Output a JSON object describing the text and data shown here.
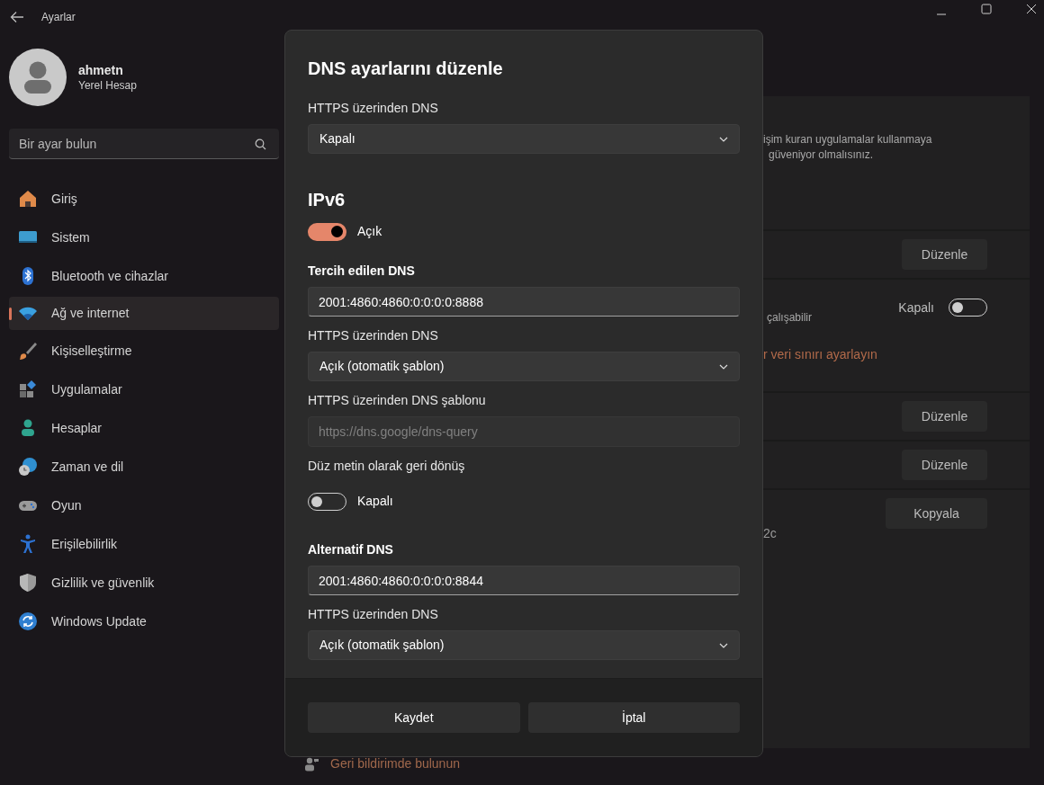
{
  "window": {
    "title": "Ayarlar"
  },
  "user": {
    "name": "ahmetn",
    "account_type": "Yerel Hesap"
  },
  "search": {
    "placeholder": "Bir ayar bulun"
  },
  "sidebar": {
    "items": [
      {
        "label": "Giriş",
        "selected": false
      },
      {
        "label": "Sistem",
        "selected": false
      },
      {
        "label": "Bluetooth ve cihazlar",
        "selected": false
      },
      {
        "label": "Ağ ve internet",
        "selected": true
      },
      {
        "label": "Kişiselleştirme",
        "selected": false
      },
      {
        "label": "Uygulamalar",
        "selected": false
      },
      {
        "label": "Hesaplar",
        "selected": false
      },
      {
        "label": "Zaman ve dil",
        "selected": false
      },
      {
        "label": "Oyun",
        "selected": false
      },
      {
        "label": "Erişilebilirlik",
        "selected": false
      },
      {
        "label": "Gizlilik ve güvenlik",
        "selected": false
      },
      {
        "label": "Windows Update",
        "selected": false
      }
    ]
  },
  "background_panel": {
    "description_lines": [
      "işim kuran uygulamalar kullanmaya",
      "güveniyor olmalısınız."
    ],
    "rows": [
      {
        "kind": "button",
        "button": "Düzenle"
      },
      {
        "kind": "toggle",
        "text": "çalışabilir",
        "toggle_label": "Kapalı",
        "on": false,
        "link": "r veri sınırı ayarlayın"
      },
      {
        "kind": "button",
        "button": "Düzenle"
      },
      {
        "kind": "button",
        "button": "Düzenle"
      },
      {
        "kind": "button",
        "button": "Kopyala",
        "text": "2c"
      }
    ],
    "feedback_link": "Geri bildirimde bulunun"
  },
  "dialog": {
    "title": "DNS ayarlarını düzenle",
    "items": [
      {
        "kind": "dropdown",
        "label": "HTTPS üzerinden DNS",
        "value": "Kapalı"
      },
      {
        "kind": "heading",
        "text": "IPv6"
      },
      {
        "kind": "toggle",
        "state_label": "Açık",
        "on": true
      },
      {
        "kind": "address_input",
        "label": "Tercih edilen DNS",
        "value": "2001:4860:4860:0:0:0:0:8888"
      },
      {
        "kind": "dropdown",
        "label": "HTTPS üzerinden DNS",
        "value": "Açık (otomatik şablon)"
      },
      {
        "kind": "text_input",
        "label": "HTTPS üzerinden DNS şablonu",
        "placeholder": "https://dns.google/dns-query"
      },
      {
        "kind": "toggle",
        "label": "Düz metin olarak geri dönüş",
        "state_label": "Kapalı",
        "on": false
      },
      {
        "kind": "address_input",
        "label": "Alternatif DNS",
        "value": "2001:4860:4860:0:0:0:0:8844"
      },
      {
        "kind": "dropdown",
        "label": "HTTPS üzerinden DNS",
        "value": "Açık (otomatik şablon)"
      }
    ],
    "buttons": [
      {
        "label": "Kaydet"
      },
      {
        "label": "İptal"
      }
    ]
  }
}
